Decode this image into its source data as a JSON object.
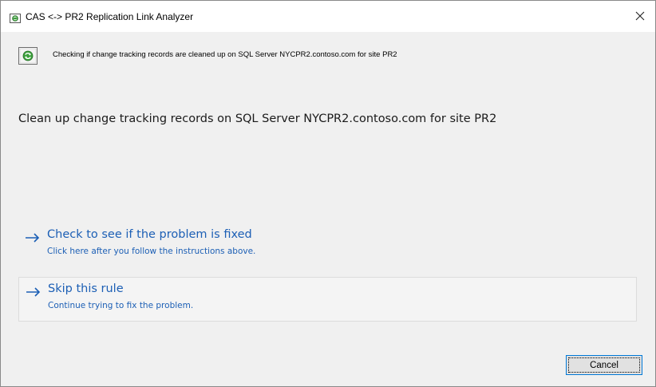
{
  "window": {
    "title": "CAS <-> PR2 Replication Link Analyzer",
    "close_glyph": "✕"
  },
  "status": {
    "text": "Checking if change tracking records are cleaned up on SQL Server NYCPR2.contoso.com for site PR2",
    "icon": "progress-icon"
  },
  "instruction": {
    "text": "Clean up change tracking records on SQL Server NYCPR2.contoso.com for site PR2"
  },
  "commands": [
    {
      "title": "Check to see if the problem is fixed",
      "subtitle": "Click here after you follow the instructions above."
    },
    {
      "title": "Skip this rule",
      "subtitle": "Continue trying to fix the problem."
    }
  ],
  "footer": {
    "cancel_label": "Cancel"
  },
  "colors": {
    "link": "#1c5fb5",
    "dialog_background": "#f0f0f0",
    "focus_border": "#0078d7"
  }
}
